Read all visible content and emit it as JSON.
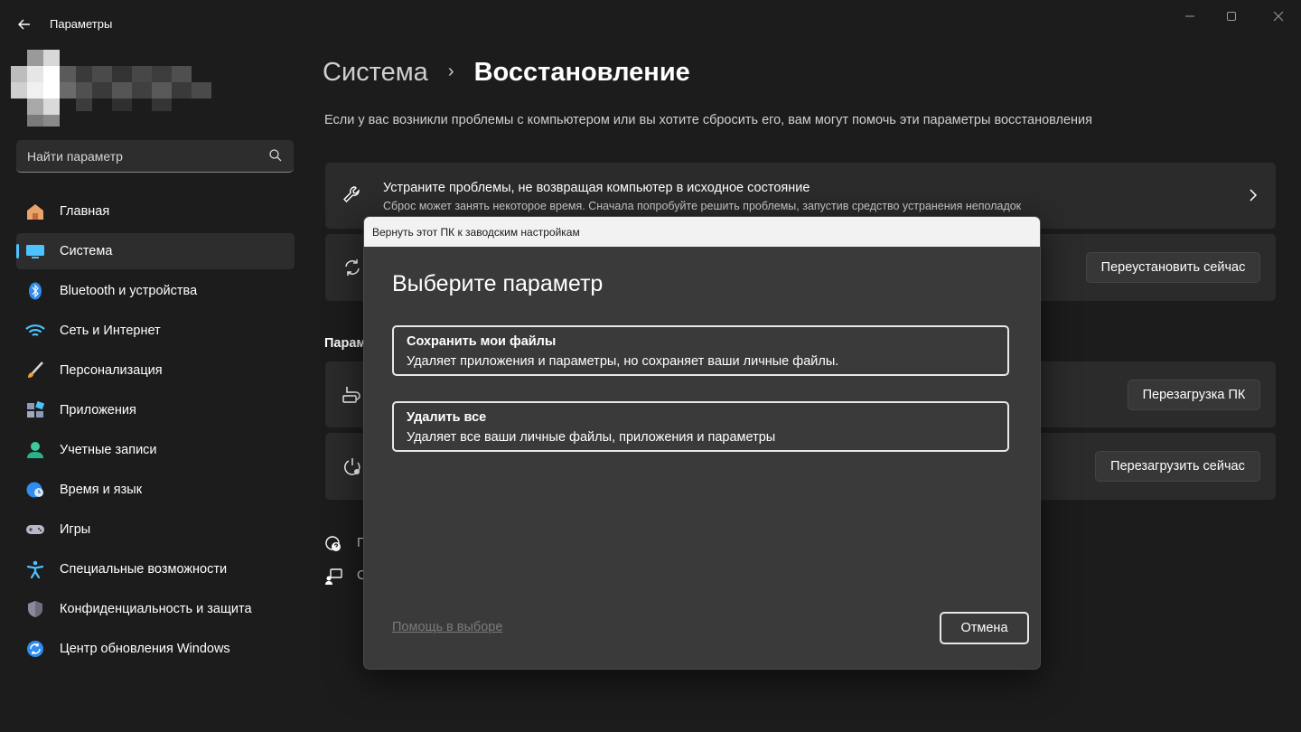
{
  "window": {
    "title": "Параметры",
    "back_icon": "arrow-left-icon",
    "controls": [
      "minimize-icon",
      "maximize-icon",
      "close-icon"
    ]
  },
  "search": {
    "placeholder": "Найти параметр",
    "icon": "search-icon"
  },
  "sidebar": {
    "items": [
      {
        "label": "Главная",
        "icon": "home-icon",
        "active": false
      },
      {
        "label": "Система",
        "icon": "monitor-icon",
        "active": true
      },
      {
        "label": "Bluetooth и устройства",
        "icon": "bluetooth-icon",
        "active": false
      },
      {
        "label": "Сеть и Интернет",
        "icon": "wifi-icon",
        "active": false
      },
      {
        "label": "Персонализация",
        "icon": "brush-icon",
        "active": false
      },
      {
        "label": "Приложения",
        "icon": "apps-icon",
        "active": false
      },
      {
        "label": "Учетные записи",
        "icon": "user-icon",
        "active": false
      },
      {
        "label": "Время и язык",
        "icon": "globe-clock-icon",
        "active": false
      },
      {
        "label": "Игры",
        "icon": "gamepad-icon",
        "active": false
      },
      {
        "label": "Специальные возможности",
        "icon": "accessibility-icon",
        "active": false
      },
      {
        "label": "Конфиденциальность и защита",
        "icon": "shield-icon",
        "active": false
      },
      {
        "label": "Центр обновления Windows",
        "icon": "update-icon",
        "active": false
      }
    ],
    "accent": "#4cc2ff"
  },
  "main": {
    "breadcrumb": {
      "parent": "Система",
      "separator": "›",
      "current": "Восстановление"
    },
    "subtitle": "Если у вас возникли проблемы с компьютером или вы хотите сбросить его, вам могут помочь эти параметры восстановления",
    "fix_card": {
      "title": "Устраните проблемы, не возвращая компьютер в исходное состояние",
      "desc": "Сброс может занять некоторое время. Сначала попробуйте решить проблемы, запустив средство устранения неполадок",
      "icon": "wrench-icon"
    },
    "reset_card": {
      "icon": "reset-icon",
      "button": "Переустановить сейчас"
    },
    "section_label": "Парам",
    "go_back_card": {
      "icon": "go-back-icon",
      "button": "Перезагрузка ПК"
    },
    "advanced_card": {
      "icon": "advanced-startup-icon",
      "button": "Перезагрузить сейчас"
    },
    "links": [
      {
        "icon": "help-icon",
        "text": "П"
      },
      {
        "icon": "feedback-icon",
        "text": "С"
      }
    ]
  },
  "dialog": {
    "title": "Вернуть этот ПК к заводским настройкам",
    "heading": "Выберите параметр",
    "options": [
      {
        "title": "Сохранить мои файлы",
        "desc": "Удаляет приложения и параметры, но сохраняет ваши личные файлы."
      },
      {
        "title": "Удалить все",
        "desc": "Удаляет все ваши личные файлы, приложения и параметры"
      }
    ],
    "help_link": "Помощь в выборе",
    "cancel": "Отмена"
  }
}
